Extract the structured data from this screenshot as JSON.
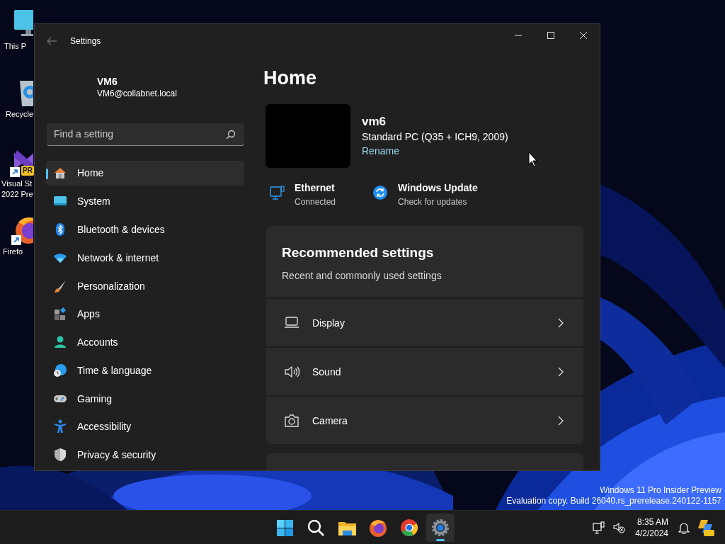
{
  "desktop": {
    "icons": [
      {
        "lines": [
          "This P"
        ]
      },
      {
        "lines": [
          "Recycle"
        ]
      },
      {
        "lines": [
          "Visual St",
          "2022 Pre"
        ],
        "badge": "PR"
      },
      {
        "lines": [
          "Firefo"
        ]
      }
    ],
    "watermark": [
      "Windows 11 Pro Insider Preview",
      "Evaluation copy. Build 26040.rs_prerelease.240122-1157"
    ]
  },
  "window": {
    "title": "Settings",
    "user": {
      "name": "VM6",
      "email": "VM6@collabnet.local"
    },
    "search": {
      "placeholder": "Find a setting"
    },
    "nav": [
      {
        "label": "Home",
        "selected": true
      },
      {
        "label": "System",
        "selected": false
      },
      {
        "label": "Bluetooth & devices",
        "selected": false
      },
      {
        "label": "Network & internet",
        "selected": false
      },
      {
        "label": "Personalization",
        "selected": false
      },
      {
        "label": "Apps",
        "selected": false
      },
      {
        "label": "Accounts",
        "selected": false
      },
      {
        "label": "Time & language",
        "selected": false
      },
      {
        "label": "Gaming",
        "selected": false
      },
      {
        "label": "Accessibility",
        "selected": false
      },
      {
        "label": "Privacy & security",
        "selected": false
      }
    ],
    "page_title": "Home",
    "device": {
      "name": "vm6",
      "model": "Standard PC (Q35 + ICH9, 2009)",
      "rename": "Rename"
    },
    "status": [
      {
        "title": "Ethernet",
        "subtitle": "Connected"
      },
      {
        "title": "Windows Update",
        "subtitle": "Check for updates"
      }
    ],
    "recommended": {
      "title": "Recommended settings",
      "subtitle": "Recent and commonly used settings",
      "items": [
        {
          "label": "Display"
        },
        {
          "label": "Sound"
        },
        {
          "label": "Camera"
        }
      ]
    }
  },
  "taskbar": {
    "apps": [
      {
        "selected": false
      },
      {
        "selected": false
      },
      {
        "selected": false
      },
      {
        "selected": false
      },
      {
        "selected": false
      },
      {
        "selected": true
      }
    ],
    "time": "8:35 AM",
    "date": "4/2/2024"
  }
}
